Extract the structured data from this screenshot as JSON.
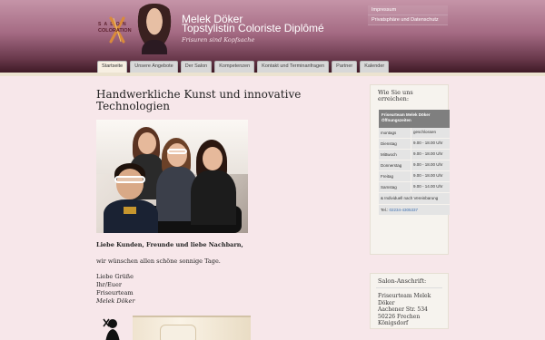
{
  "header": {
    "logo_line1": "S  A  L  O  N",
    "logo_line2": "COLORATION",
    "site_name": "Melek Döker",
    "site_sub": "Topstylistin Coloriste Diplômé",
    "tagline": "Frisuren sind Kopfsache",
    "top_links": [
      "Impressum",
      "Privatsphäre und Datenschutz"
    ]
  },
  "nav": {
    "tabs": [
      "Startseite",
      "Unsere Angebote",
      "Der Salon",
      "Kompetenzen",
      "Kontakt und Terminanfragen",
      "Partner",
      "Kalender"
    ],
    "active_index": 0
  },
  "main": {
    "title_line1": "Handwerkliche Kunst und innovative",
    "title_line2": "Technologien",
    "greeting": "Liebe Kunden, Freunde und liebe Nachbarn,",
    "wish": "wir wünschen allen schöne sonnige Tage.",
    "sign_lines": [
      "Liebe Grüße",
      "Ihr/Euer",
      "Friseurteam"
    ],
    "sign_name": "Melek Döker"
  },
  "sidebar": {
    "hours_box_title": "Wie Sie uns erreichen:",
    "hours_header": "Friseurteam Melek Döker Öffnungszeiten",
    "hours": [
      {
        "day": "montags",
        "time": "geschlossen"
      },
      {
        "day": "Dienstag",
        "time": "9.00 - 18.00 Uhr"
      },
      {
        "day": "Mittwoch",
        "time": "9.00 - 18.00 Uhr"
      },
      {
        "day": "Donnerstag",
        "time": "9.00 - 18.00 Uhr"
      },
      {
        "day": "Freitag",
        "time": "9.00 - 18.00 Uhr"
      },
      {
        "day": "Samstag",
        "time": "9.00 - 14.00 Uhr"
      }
    ],
    "note": "& Individuell nach Vereinbarung",
    "tel_label": "Tel.:",
    "tel_number": "02234-4305337",
    "address_title": "Salon-Anschrift:",
    "address_lines": [
      "Friseurteam Melek Döker",
      "Aachener Str. 534",
      "50226 Frechen",
      "Königsdorf"
    ]
  },
  "colors": {
    "header_top": "#c594a8",
    "header_bottom": "#3f1a26",
    "page_bg": "#f7e7ea",
    "link_blue": "#3b6fb1"
  }
}
